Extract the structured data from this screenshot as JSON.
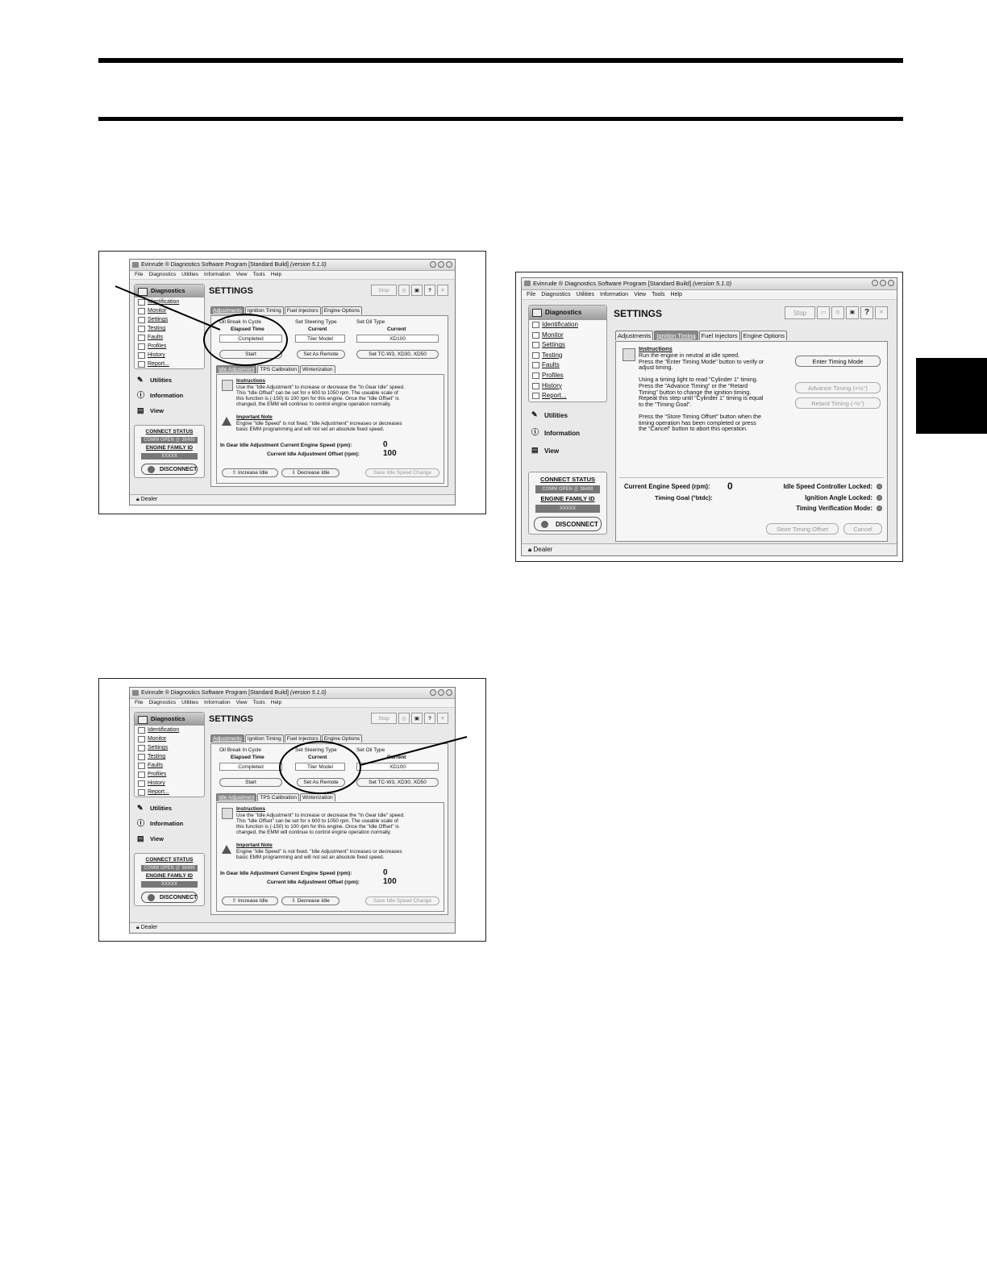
{
  "app": {
    "title": "Evinrude ® Diagnostics Software Program [Standard Build]",
    "version": "(version 5.1.0)",
    "menu": [
      "File",
      "Diagnostics",
      "Utilities",
      "Information",
      "View",
      "Tools",
      "Help"
    ],
    "sidebar": {
      "header": "Diagnostics",
      "items_left": [
        "Identification",
        "Monitor",
        "Settings",
        "Testing",
        "Faults",
        "Profiles",
        "History",
        "Report..."
      ],
      "items_right": [
        "Identification",
        "Monitor",
        "Settings",
        "Testing",
        "Faults",
        "Profiles",
        "History",
        "Report..."
      ],
      "links": [
        "Utilities",
        "Information",
        "View"
      ],
      "connect_status": "CONNECT STATUS",
      "connect_value": "COMM OPEN @ 38400",
      "engine_family": "ENGINE FAMILY ID",
      "engine_family_value": "XXXXX",
      "disconnect": "DISCONNECT"
    },
    "page_title": "SETTINGS",
    "stop": "Stop",
    "help": "?",
    "statusbar": "Dealer"
  },
  "adjustments": {
    "tabs": [
      "Adjustments",
      "Ignition Timing",
      "Fuel Injectors",
      "Engine Options"
    ],
    "oil_break": {
      "label": "Oil Break In Cycle",
      "sub": "Elapsed Time",
      "value": "Completed",
      "button": "Start"
    },
    "steering": {
      "label": "Set Steering Type",
      "sub": "Current",
      "value": "Tiler Model",
      "button": "Set As Remote"
    },
    "oil_type": {
      "label": "Set Oil Type",
      "sub": "Current",
      "value": "XD100",
      "button": "Set TC-W3, XD30, XD50"
    },
    "subtabs": [
      "Idle Adjustment",
      "TPS Calibration",
      "Winterization"
    ],
    "instructions_title": "Instructions",
    "instructions": [
      "Use the \"Idle Adjustment\" to increase or decrease the \"In Gear Idle\" speed.",
      "This \"Idle Offset\" can be set for ± 600 to 1050 rpm.  The useable scale of",
      "this function is (-150) to 100 rpm for this engine.  Once the \"Idle Offset\" is",
      "changed, the EMM will continue to control engine operation normally."
    ],
    "note_title": "Important Note",
    "note": [
      "Engine \"Idle Speed\" is not fixed.  \"Idle Adjustment\" increases or decreases",
      "basic EMM programming and will not set an absolute fixed speed."
    ],
    "speed_label": "In Gear Idle Adjustment Current Engine Speed (rpm):",
    "speed_value": "0",
    "offset_label": "Current Idle Adjustment Offset (rpm):",
    "offset_value": "100",
    "increase": "Increase Idle",
    "decrease": "Decrease Idle",
    "save": "Save Idle Speed Change"
  },
  "timing": {
    "instructions_title": "Instructions",
    "lines": [
      "Run the engine in neutral at idle speed.",
      "Press the \"Enter Timing Mode\" button to verify or",
      "adjust timing.",
      "",
      "Using a timing light to read \"Cylinder 1\" timing.",
      "Press the \"Advance Timing\" or the \"Retard",
      "Timing\" button to change the ignition timing.",
      "Repeat this step until \"Cylinder 1\" timing is equal",
      "to the \"Timing Goal\".",
      "",
      "Press the \"Store Timing Offset\" button when the",
      "timing operation has been completed or press",
      "the \"Cancel\" button to abort this operation."
    ],
    "enter": "Enter Timing Mode",
    "advance": "Advance Timing (+½°)",
    "retard": "Retard Timing (-½°)",
    "speed_label": "Current Engine Speed (rpm):",
    "speed_value": "0",
    "goal_label": "Timing Goal (°btdc):",
    "idle_locked": "Idle Speed Controller Locked:",
    "angle_locked": "Ignition Angle Locked:",
    "verify_mode": "Timing Verification Mode:",
    "store": "Store Timing Offset",
    "cancel": "Cancel"
  }
}
